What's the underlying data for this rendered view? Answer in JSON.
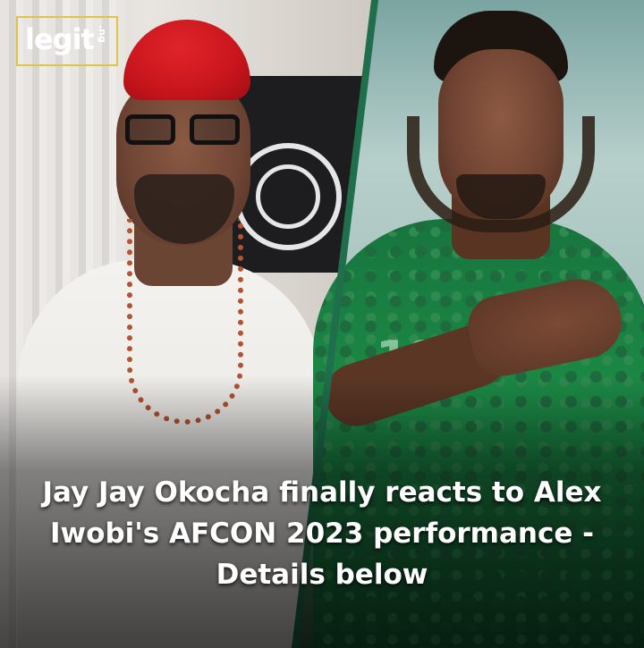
{
  "logo": {
    "word": "legit",
    "suffix": ".ng"
  },
  "headline": "Jay Jay Okocha finally reacts to Alex\nIwobi's AFCON 2023 performance   -\nDetails below",
  "jersey_number": "18",
  "colors": {
    "cap_red": "#c8151c",
    "jersey_green": "#17753e",
    "divider_green": "#1f6e4c",
    "logo_border": "#e2c34a",
    "headline_text": "#ffffff"
  }
}
